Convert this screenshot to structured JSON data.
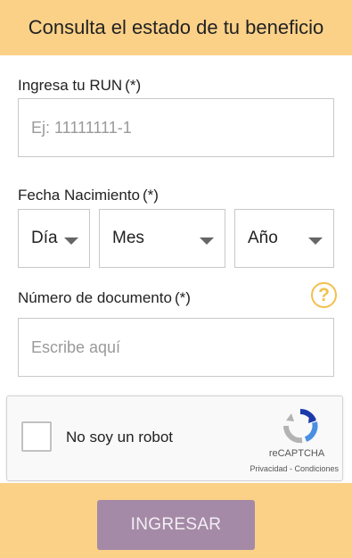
{
  "header": {
    "title": "Consulta el estado de tu beneficio"
  },
  "form": {
    "run": {
      "label": "Ingresa tu RUN",
      "required_mark": "(*)",
      "placeholder": "Ej: 11111111-1"
    },
    "birthdate": {
      "label": "Fecha Nacimiento",
      "required_mark": "(*)",
      "day": "Día",
      "month": "Mes",
      "year": "Año"
    },
    "document": {
      "label": "Número de documento",
      "required_mark": "(*)",
      "placeholder": "Escribe aquí",
      "help_icon": "help-circle-icon",
      "help_glyph": "?"
    }
  },
  "captcha": {
    "text": "No soy un robot",
    "brand": "reCAPTCHA",
    "privacy": "Privacidad",
    "separator": " - ",
    "terms": "Condiciones",
    "logo_icon": "recaptcha-logo-icon"
  },
  "footer": {
    "submit_label": "INGRESAR"
  },
  "colors": {
    "header_bg": "#fbd188",
    "button_bg": "#a48aa6",
    "help_icon": "#f3c04f",
    "border": "#c8c8c8"
  }
}
